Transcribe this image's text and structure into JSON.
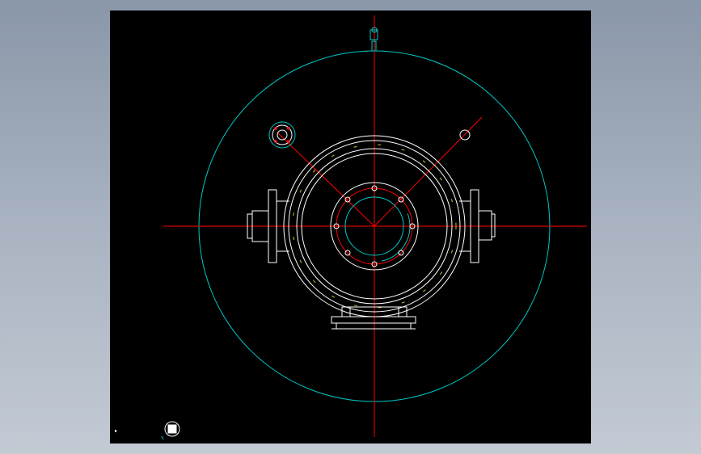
{
  "colors": {
    "background_outer": "#9aa6b6",
    "canvas": "#000000",
    "centerline": "#ff0000",
    "outline": "#ffffff",
    "cyan": "#00c8c8",
    "yellow_dash": "#c8c832"
  },
  "icons": {
    "ucs_icon": "ucs-icon",
    "nameplate_icon": "level-indicator-icon"
  },
  "drawing": {
    "type": "mechanical-cad-end-view",
    "bolt_holes_main_flange": 8
  }
}
